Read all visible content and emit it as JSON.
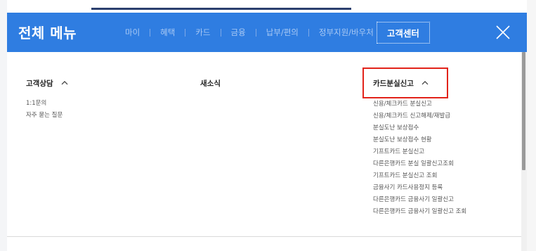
{
  "header": {
    "title": "전체 메뉴",
    "nav": [
      {
        "label": "마이",
        "active": false
      },
      {
        "label": "혜택",
        "active": false
      },
      {
        "label": "카드",
        "active": false
      },
      {
        "label": "금융",
        "active": false
      },
      {
        "label": "납부/편의",
        "active": false
      },
      {
        "label": "정부지원/바우처",
        "active": false
      },
      {
        "label": "고객센터",
        "active": true
      }
    ],
    "close_icon": "close-icon"
  },
  "columns": [
    {
      "heading": "고객상담",
      "expanded": true,
      "items": [
        "1:1문의",
        "자주 묻는 질문"
      ]
    },
    {
      "heading": "새소식",
      "expanded": false,
      "items": []
    },
    {
      "heading": "카드분실신고",
      "expanded": true,
      "highlighted": true,
      "items": [
        "신용/체크카드 분실신고",
        "신용/체크카드 신고해제/재발급",
        "분실도난 보상접수",
        "분실도난 보상접수 현황",
        "기프트카드 분실신고",
        "다른은행카드 분실 일괄신고조회",
        "기프트카드 분실신고 조회",
        "금융사기 카드사용정지 등록",
        "다른은행카드 금융사기 일괄신고",
        "다른은행카드 금융사기 일괄신고 조회"
      ]
    }
  ],
  "colors": {
    "header_bg": "#2f7de1",
    "highlight_border": "#e2231a",
    "nav_inactive": "#a9c9f4"
  }
}
